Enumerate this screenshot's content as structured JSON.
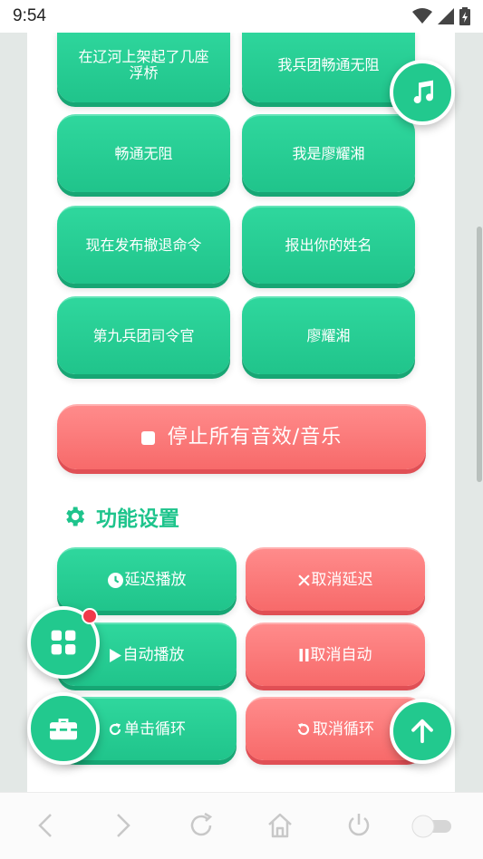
{
  "status_bar": {
    "time": "9:54",
    "icons": [
      "wifi-icon",
      "cell-signal-icon",
      "battery-charging-icon"
    ]
  },
  "sound_buttons": [
    {
      "label": "在辽河上架起了几座浮桥"
    },
    {
      "label": "我兵团畅通无阻"
    },
    {
      "label": "畅通无阻"
    },
    {
      "label": "我是廖耀湘"
    },
    {
      "label": "现在发布撤退命令"
    },
    {
      "label": "报出你的姓名"
    },
    {
      "label": "第九兵团司令官"
    },
    {
      "label": "廖耀湘"
    }
  ],
  "stop_all": {
    "label": "停止所有音效/音乐",
    "icon": "stop-square-icon"
  },
  "settings_section": {
    "title": "功能设置",
    "icon": "gear-icon"
  },
  "settings_buttons": {
    "delay_play": {
      "label": "延迟播放",
      "icon": "clock-icon"
    },
    "cancel_delay": {
      "label": "取消延迟",
      "icon": "close-x-icon"
    },
    "auto_play": {
      "label": "自动播放",
      "icon": "play-icon"
    },
    "cancel_auto": {
      "label": "取消自动",
      "icon": "pause-icon"
    },
    "single_loop": {
      "label": "单击循环",
      "icon": "redo-icon"
    },
    "cancel_loop": {
      "label": "取消循环",
      "icon": "undo-icon"
    }
  },
  "floating_buttons": [
    "music-note-icon",
    "grid-menu-icon",
    "toolbox-icon",
    "arrow-up-icon"
  ],
  "nav_bar": [
    "back-icon",
    "forward-icon",
    "reload-icon",
    "home-icon",
    "power-icon",
    "toggle-switch"
  ],
  "colors": {
    "green": "#22c98e",
    "red": "#f76a6a",
    "accent_text": "#1ec48c",
    "badge": "#f03a4a"
  }
}
